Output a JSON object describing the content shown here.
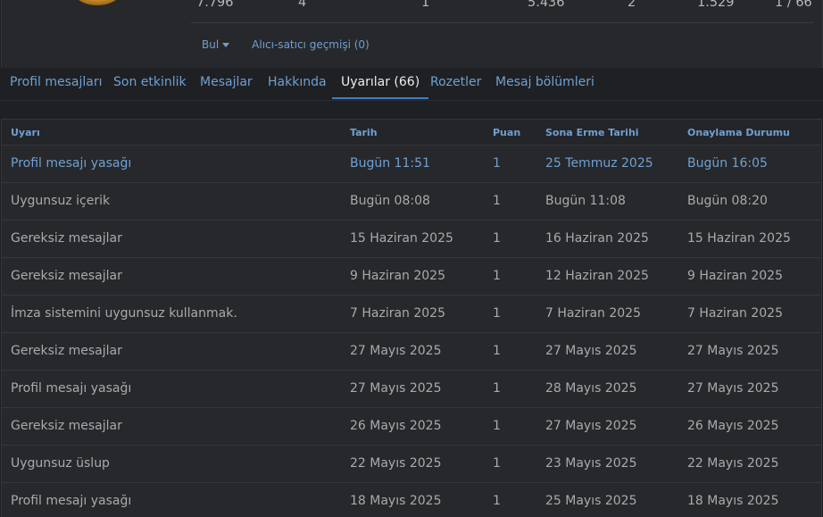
{
  "profile": {
    "stats": [
      "7.796",
      "4",
      "1",
      "5.436",
      "2",
      "1.529",
      "1 / 66"
    ],
    "find_label": "Bul",
    "trader_history_label": "Alıcı-satıcı geçmişi (0)"
  },
  "tabs": [
    {
      "label": "Profil mesajları",
      "active": false
    },
    {
      "label": "Son etkinlik",
      "active": false
    },
    {
      "label": "Mesajlar",
      "active": false
    },
    {
      "label": "Hakkında",
      "active": false
    },
    {
      "label": "Uyarılar (66)",
      "active": true
    },
    {
      "label": "Rozetler",
      "active": false
    },
    {
      "label": "Mesaj bölümleri",
      "active": false
    }
  ],
  "table": {
    "headers": [
      "Uyarı",
      "Tarih",
      "Puan",
      "Sona Erme Tarihi",
      "Onaylama Durumu"
    ],
    "rows": [
      {
        "warning": "Profil mesajı yasağı",
        "date": "Bugün 11:51",
        "points": "1",
        "expires": "25 Temmuz 2025",
        "acknowledged": "Bugün 16:05",
        "highlight": true
      },
      {
        "warning": "Uygunsuz içerik",
        "date": "Bugün 08:08",
        "points": "1",
        "expires": "Bugün 11:08",
        "acknowledged": "Bugün 08:20",
        "highlight": false
      },
      {
        "warning": "Gereksiz mesajlar",
        "date": "15 Haziran 2025",
        "points": "1",
        "expires": "16 Haziran 2025",
        "acknowledged": "15 Haziran 2025",
        "highlight": false
      },
      {
        "warning": "Gereksiz mesajlar",
        "date": "9 Haziran 2025",
        "points": "1",
        "expires": "12 Haziran 2025",
        "acknowledged": "9 Haziran 2025",
        "highlight": false
      },
      {
        "warning": "İmza sistemini uygunsuz kullanmak.",
        "date": "7 Haziran 2025",
        "points": "1",
        "expires": "7 Haziran 2025",
        "acknowledged": "7 Haziran 2025",
        "highlight": false
      },
      {
        "warning": "Gereksiz mesajlar",
        "date": "27 Mayıs 2025",
        "points": "1",
        "expires": "27 Mayıs 2025",
        "acknowledged": "27 Mayıs 2025",
        "highlight": false
      },
      {
        "warning": "Profil mesajı yasağı",
        "date": "27 Mayıs 2025",
        "points": "1",
        "expires": "28 Mayıs 2025",
        "acknowledged": "27 Mayıs 2025",
        "highlight": false
      },
      {
        "warning": "Gereksiz mesajlar",
        "date": "26 Mayıs 2025",
        "points": "1",
        "expires": "27 Mayıs 2025",
        "acknowledged": "26 Mayıs 2025",
        "highlight": false
      },
      {
        "warning": "Uygunsuz üslup",
        "date": "22 Mayıs 2025",
        "points": "1",
        "expires": "23 Mayıs 2025",
        "acknowledged": "22 Mayıs 2025",
        "highlight": false
      },
      {
        "warning": "Profil mesajı yasağı",
        "date": "18 Mayıs 2025",
        "points": "1",
        "expires": "25 Mayıs 2025",
        "acknowledged": "18 Mayıs 2025",
        "highlight": false
      }
    ]
  },
  "colors": {
    "background": "#1f2023",
    "panel": "#27282b",
    "link": "#6fa0d2",
    "text": "#a9aaac",
    "active_tab_underline": "#3f81c4"
  }
}
